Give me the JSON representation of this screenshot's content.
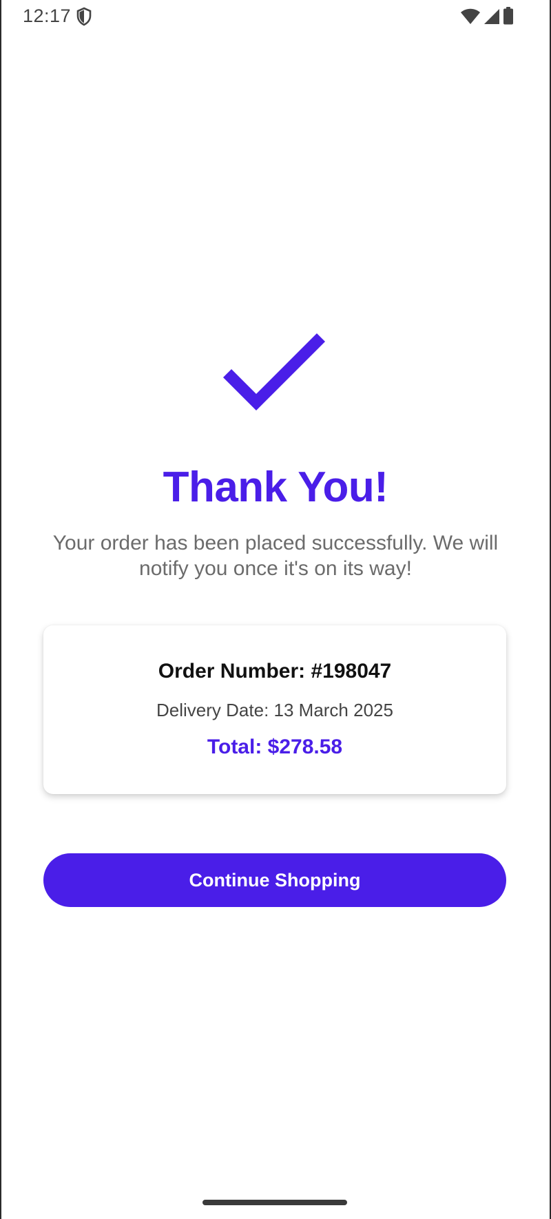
{
  "status_bar": {
    "time": "12:17",
    "icons": [
      "shield-icon",
      "wifi-icon",
      "signal-icon",
      "battery-icon"
    ]
  },
  "confirmation": {
    "icon": "checkmark-icon",
    "title": "Thank You!",
    "message": "Your order has been placed successfully. We will notify you once it's on its way!"
  },
  "order": {
    "order_number": "Order Number: #198047",
    "delivery_date": "Delivery Date: 13 March 2025",
    "total": "Total: $278.58"
  },
  "actions": {
    "continue_label": "Continue Shopping"
  },
  "colors": {
    "accent": "#4a1ee8",
    "subtitle_text": "#6b6b6b",
    "background": "#ffffff"
  }
}
